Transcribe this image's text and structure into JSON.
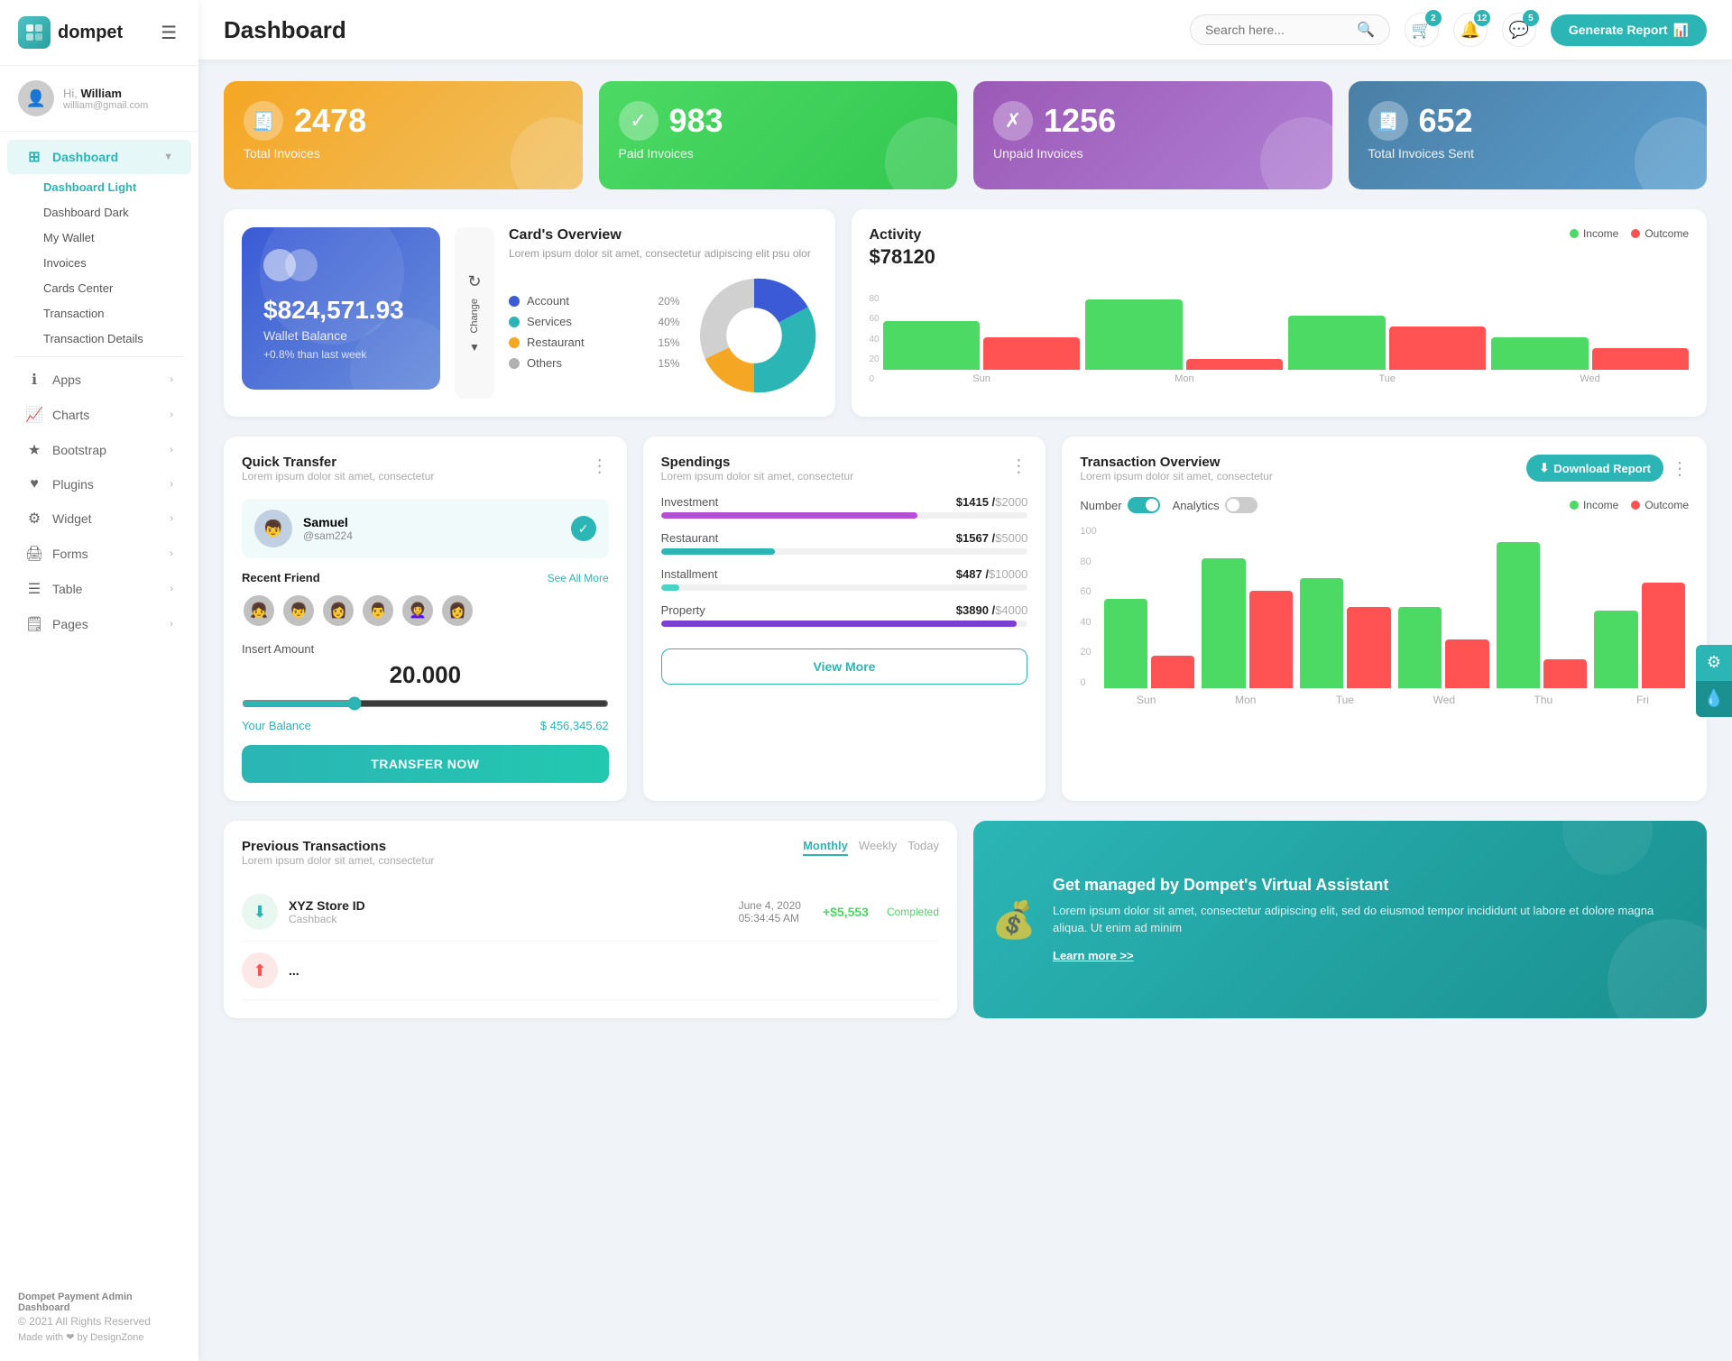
{
  "app": {
    "name": "dompet",
    "logoText": "d"
  },
  "header": {
    "title": "Dashboard",
    "search_placeholder": "Search here...",
    "generate_btn": "Generate Report",
    "badges": {
      "cart": "2",
      "bell": "12",
      "chat": "5"
    }
  },
  "user": {
    "greeting": "Hi,",
    "name": "William",
    "email": "william@gmail.com",
    "avatar_emoji": "👤"
  },
  "sidebar": {
    "main_nav": [
      {
        "label": "Dashboard",
        "icon": "⊞",
        "active": true,
        "hasChildren": true
      },
      {
        "label": "Apps",
        "icon": "ℹ",
        "active": false,
        "hasChildren": true
      },
      {
        "label": "Charts",
        "icon": "📈",
        "active": false,
        "hasChildren": true
      },
      {
        "label": "Bootstrap",
        "icon": "★",
        "active": false,
        "hasChildren": true
      },
      {
        "label": "Plugins",
        "icon": "♥",
        "active": false,
        "hasChildren": true
      },
      {
        "label": "Widget",
        "icon": "⚙",
        "active": false,
        "hasChildren": true
      },
      {
        "label": "Forms",
        "icon": "🖨",
        "active": false,
        "hasChildren": true
      },
      {
        "label": "Table",
        "icon": "☰",
        "active": false,
        "hasChildren": true
      },
      {
        "label": "Pages",
        "icon": "🗒",
        "active": false,
        "hasChildren": true
      }
    ],
    "sub_nav": [
      {
        "label": "Dashboard Light",
        "active": true
      },
      {
        "label": "Dashboard Dark",
        "active": false
      },
      {
        "label": "My Wallet",
        "active": false
      },
      {
        "label": "Invoices",
        "active": false
      },
      {
        "label": "Cards Center",
        "active": false
      },
      {
        "label": "Transaction",
        "active": false
      },
      {
        "label": "Transaction Details",
        "active": false
      }
    ],
    "footer": {
      "brand": "Dompet Payment Admin Dashboard",
      "copyright": "© 2021 All Rights Reserved",
      "made_with": "Made with ❤ by DesignZone"
    }
  },
  "stats": [
    {
      "number": "2478",
      "label": "Total Invoices",
      "icon": "🧾",
      "theme": "orange"
    },
    {
      "number": "983",
      "label": "Paid Invoices",
      "icon": "✓",
      "theme": "green"
    },
    {
      "number": "1256",
      "label": "Unpaid Invoices",
      "icon": "✗",
      "theme": "purple"
    },
    {
      "number": "652",
      "label": "Total Invoices Sent",
      "icon": "🧾",
      "theme": "teal"
    }
  ],
  "wallet": {
    "amount": "$824,571.93",
    "label": "Wallet Balance",
    "change": "+0.8% than last week"
  },
  "cards_overview": {
    "title": "Card's Overview",
    "desc": "Lorem ipsum dolor sit amet, consectetur adipiscing elit psu olor",
    "items": [
      {
        "label": "Account",
        "pct": "20%",
        "color": "#3a5bd5"
      },
      {
        "label": "Services",
        "pct": "40%",
        "color": "#2bb5b5"
      },
      {
        "label": "Restaurant",
        "pct": "15%",
        "color": "#f5a623"
      },
      {
        "label": "Others",
        "pct": "15%",
        "color": "#b0b0b0"
      }
    ]
  },
  "activity": {
    "title": "Activity",
    "amount": "$78120",
    "legend": [
      {
        "label": "Income",
        "color": "#4cd964"
      },
      {
        "label": "Outcome",
        "color": "#ff5252"
      }
    ],
    "bars": [
      {
        "day": "Sun",
        "income": 45,
        "outcome": 30
      },
      {
        "day": "Mon",
        "income": 65,
        "outcome": 10
      },
      {
        "day": "Tue",
        "income": 50,
        "outcome": 40
      },
      {
        "day": "Wed",
        "income": 30,
        "outcome": 20
      }
    ],
    "y_labels": [
      "0",
      "20",
      "40",
      "60",
      "80"
    ]
  },
  "quick_transfer": {
    "title": "Quick Transfer",
    "desc": "Lorem ipsum dolor sit amet, consectetur",
    "user": {
      "name": "Samuel",
      "handle": "@sam224",
      "avatar_emoji": "👦"
    },
    "recent_label": "Recent Friend",
    "see_all": "See All More",
    "friends": [
      "👧",
      "👦",
      "👩",
      "👨",
      "👩‍🦱",
      "👩"
    ],
    "insert_amount_label": "Insert Amount",
    "amount": "20.000",
    "balance_label": "Your Balance",
    "balance": "$ 456,345.62",
    "transfer_btn": "TRANSFER NOW"
  },
  "spendings": {
    "title": "Spendings",
    "desc": "Lorem ipsum dolor sit amet, consectetur",
    "items": [
      {
        "label": "Investment",
        "amount": "$1415",
        "max": "$2000",
        "pct": 70,
        "color": "#b44fd4"
      },
      {
        "label": "Restaurant",
        "amount": "$1567",
        "max": "$5000",
        "pct": 31,
        "color": "#2bb5b5"
      },
      {
        "label": "Installment",
        "amount": "$487",
        "max": "$10000",
        "pct": 5,
        "color": "#4ad4c4"
      },
      {
        "label": "Property",
        "amount": "$3890",
        "max": "$4000",
        "pct": 97,
        "color": "#7c3fd4"
      }
    ],
    "view_more": "View More"
  },
  "tx_overview": {
    "title": "Transaction Overview",
    "desc": "Lorem ipsum dolor sit amet, consectetur",
    "download_btn": "Download Report",
    "controls": {
      "number_label": "Number",
      "analytics_label": "Analytics"
    },
    "legend": [
      {
        "label": "Income",
        "color": "#4cd964"
      },
      {
        "label": "Outcome",
        "color": "#ff5252"
      }
    ],
    "bars": [
      {
        "day": "Sun",
        "income": 55,
        "outcome": 20
      },
      {
        "day": "Mon",
        "income": 80,
        "outcome": 60
      },
      {
        "day": "Tue",
        "income": 68,
        "outcome": 50
      },
      {
        "day": "Wed",
        "income": 50,
        "outcome": 30
      },
      {
        "day": "Thu",
        "income": 90,
        "outcome": 18
      },
      {
        "day": "Fri",
        "income": 48,
        "outcome": 65
      }
    ],
    "y_labels": [
      "0",
      "20",
      "40",
      "60",
      "80",
      "100"
    ]
  },
  "prev_transactions": {
    "title": "Previous Transactions",
    "desc": "Lorem ipsum dolor sit amet, consectetur",
    "tabs": [
      "Monthly",
      "Weekly",
      "Today"
    ],
    "active_tab": "Monthly",
    "items": [
      {
        "icon": "⬇",
        "icon_type": "green",
        "name": "XYZ Store ID",
        "type": "Cashback",
        "date": "June 4, 2020",
        "time": "05:34:45 AM",
        "amount": "+$5,553",
        "amount_type": "pos",
        "status": "Completed"
      }
    ]
  },
  "va_banner": {
    "title": "Get managed by Dompet's Virtual Assistant",
    "desc": "Lorem ipsum dolor sit amet, consectetur adipiscing elit, sed do eiusmod tempor incididunt ut labore et dolore magna aliqua. Ut enim ad minim",
    "link": "Learn more >>"
  }
}
